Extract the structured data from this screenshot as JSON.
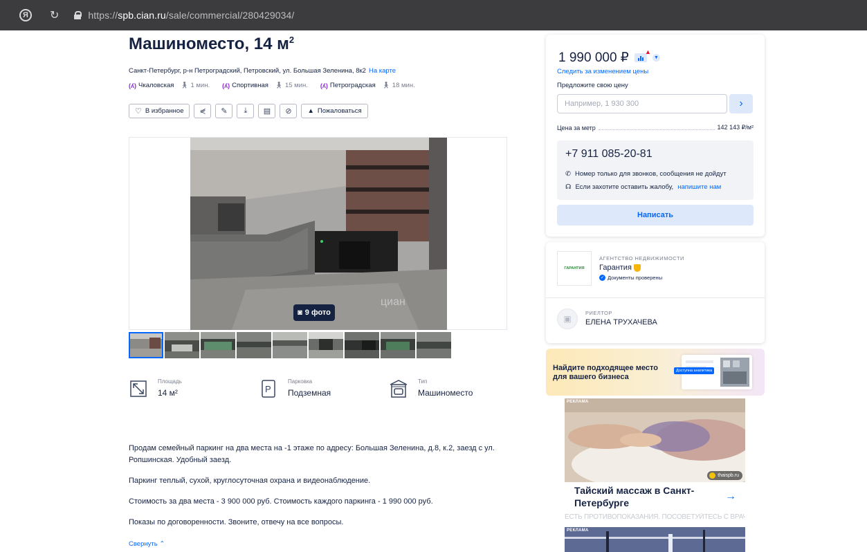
{
  "browser": {
    "url_prefix": "https://",
    "url_host": "spb.cian.ru",
    "url_path": "/sale/commercial/280429034/",
    "ya_icon": "Я"
  },
  "listing": {
    "title": "Машиноместо, 14 м",
    "title_sup": "2",
    "address": "Санкт-Петербург, р-н Петроградский, Петровский, ул. Большая Зеленина, 8к2",
    "map_link": "На карте",
    "metro": [
      {
        "name": "Чкаловская",
        "walk": "1 мин."
      },
      {
        "name": "Спортивная",
        "walk": "15 мин."
      },
      {
        "name": "Петроградская",
        "walk": "18 мин."
      }
    ],
    "actions": {
      "favorite": "В избранное",
      "complain": "Пожаловаться"
    },
    "photo_count": "9 фото",
    "watermark": "циан",
    "facts": [
      {
        "label": "Площадь",
        "value": "14 м²",
        "icon": "area-icon"
      },
      {
        "label": "Парковка",
        "value": "Подземная",
        "icon": "parking-icon"
      },
      {
        "label": "Тип",
        "value": "Машиноместо",
        "icon": "garage-icon"
      }
    ],
    "description": [
      "Продам семейный паркинг на два места на -1 этаже по адресу: Большая Зеленина, д.8, к.2, заезд с ул. Ропшинская. Удобный заезд.",
      "Паркинг теплый, сухой, круглосуточная охрана и видеонаблюдение.",
      "Стоимость за два места - 3 900 000 руб. Стоимость каждого паркинга - 1 990 000 руб.",
      "Показы по договоренности. Звоните, отвечу на все вопросы."
    ],
    "collapse": "Свернуть"
  },
  "price_card": {
    "price": "1 990 000 ₽",
    "follow": "Следить за изменением цены",
    "offer_label": "Предложите свою цену",
    "offer_placeholder": "Например, 1 930 300",
    "per_meter_label": "Цена за метр",
    "per_meter_value": "142 143 ₽/м²",
    "phone": "+7 911 085-20-81",
    "note_calls": "Номер только для звонков, сообщения не дойдут",
    "note_complaint": "Если захотите оставить жалобу,",
    "note_link": "напишите нам",
    "write": "Написать"
  },
  "agent_card": {
    "logo_text": "ГАРАНТИЯ",
    "type": "АГЕНТСТВО НЕДВИЖИМОСТИ",
    "name": "Гарантия",
    "docs": "Документы проверены",
    "role": "РИЕЛТОР",
    "realtor": "ЕЛЕНА ТРУХАЧЕВА"
  },
  "banner": {
    "text": "Найдите подходящее место для вашего бизнеса",
    "tag": "Доступна аналитика"
  },
  "ad": {
    "label": "РЕКЛАМА",
    "source": "thaispb.ru",
    "title": "Тайский массаж в Санкт-Петербурге",
    "warning": "ЕСТЬ ПРОТИВОПОКАЗАНИЯ. ПОСОВЕТУЙТЕСЬ С ВРАЧОМ",
    "label2": "РЕКЛАМА"
  },
  "colors": {
    "accent": "#0468ff",
    "text": "#152242",
    "metro": "#8b2bd2"
  }
}
